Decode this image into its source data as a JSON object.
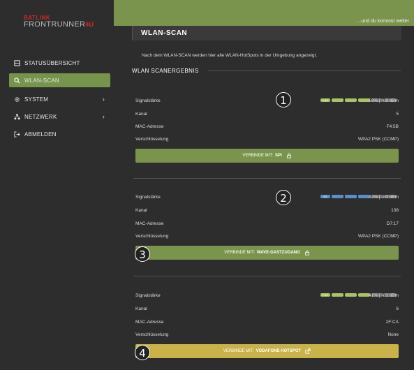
{
  "logo": {
    "line1": "BATLINK",
    "line2": "FRONTRUNNER",
    "line2_accent": "4U"
  },
  "topbar": {
    "tagline": "...und du kommst weiter"
  },
  "sidebar": {
    "items": [
      {
        "label": "STATUSÜBERSICHT",
        "icon": "status-icon",
        "active": false
      },
      {
        "label": "WLAN-SCAN",
        "icon": "search-icon",
        "active": true
      },
      {
        "label": "SYSTEM",
        "icon": "gear-icon",
        "active": false,
        "chevron": "›"
      },
      {
        "label": "NETZWERK",
        "icon": "network-icon",
        "active": false,
        "chevron": "›"
      },
      {
        "label": "ABMELDEN",
        "icon": "logout-icon",
        "active": false
      }
    ]
  },
  "page": {
    "title": "WLAN-SCAN",
    "description": "Nach dem WLAN-SCAN werden hier alle WLAN-HotSpots in der Umgebung angezeigt.",
    "section_title": "WLAN SCANERGEBNIS"
  },
  "labels": {
    "signal": "Signalstärke",
    "channel": "Kanal",
    "mac": "MAC-Adresse",
    "encryption": "Verschlüsselung",
    "connect_prefix": "VERBINDE MIT:"
  },
  "results": [
    {
      "band": "2.4G",
      "signal_value": "58% | -69 dBm",
      "signal_percent": 58,
      "filled_segments": 3,
      "channel": "5",
      "mac": "F4:5B",
      "encryption": "WPA2 PSK (CCMP)",
      "ssid": "SPI",
      "button_color": "green",
      "callout": "1",
      "fill_color": "#a7c267"
    },
    {
      "band": "5G",
      "signal_value": "42% | -80 dBm",
      "signal_percent": 42,
      "filled_segments": 3,
      "channel": "108",
      "mac": "D7:17",
      "encryption": "WPA2 PSK (CCMP)",
      "ssid": "WAVE-GASTZUGANG",
      "button_color": "green",
      "callout": "2",
      "button_callout": "3",
      "fill_color": "#5b8ec9"
    },
    {
      "band": "2.4G",
      "signal_value": "41% | -81 dBm",
      "signal_percent": 41,
      "filled_segments": 3,
      "channel": "6",
      "mac": "2F:CA",
      "encryption": "None",
      "ssid": "VODAFONE HOTSPOT",
      "button_color": "yellow",
      "button_callout": "4",
      "fill_color": "#a7c267"
    }
  ],
  "colors": {
    "accent": "#7a944d",
    "sidebar_bg": "#2d2d2d",
    "yellow": "#c9b24a",
    "blue": "#5b8ec9"
  }
}
